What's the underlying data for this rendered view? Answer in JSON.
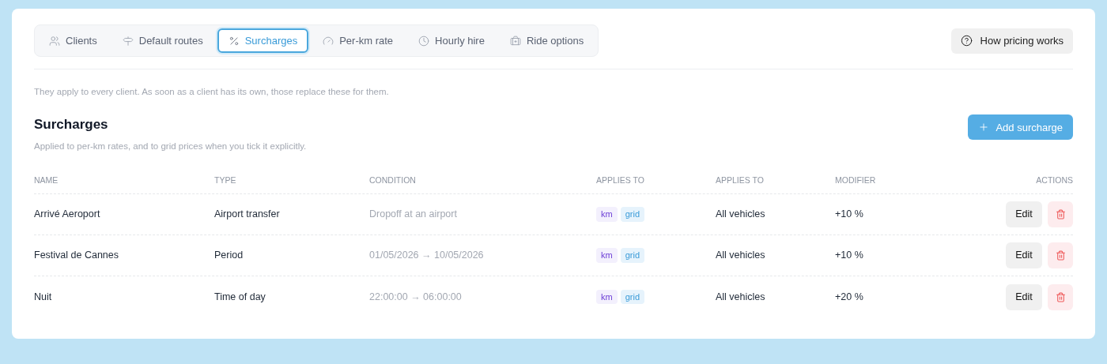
{
  "tabs": [
    {
      "label": "Clients",
      "selected": false
    },
    {
      "label": "Default routes",
      "selected": false
    },
    {
      "label": "Surcharges",
      "selected": true
    },
    {
      "label": "Per-km rate",
      "selected": false
    },
    {
      "label": "Hourly hire",
      "selected": false
    },
    {
      "label": "Ride options",
      "selected": false
    }
  ],
  "help_button": "How pricing works",
  "intro": "They apply to every client. As soon as a client has its own, those replace these for them.",
  "section": {
    "title": "Surcharges",
    "subtitle": "Applied to per-km rates, and to grid prices when you tick it explicitly.",
    "add_button": "Add surcharge"
  },
  "table": {
    "columns": [
      "NAME",
      "TYPE",
      "CONDITION",
      "APPLIES TO",
      "APPLIES TO",
      "MODIFIER",
      "ACTIONS"
    ],
    "rows": [
      {
        "name": "Arrivé Aeroport",
        "type": "Airport transfer",
        "condition": "Dropoff at an airport",
        "tags": [
          {
            "label": "km",
            "kind": "km"
          },
          {
            "label": "grid",
            "kind": "grid"
          }
        ],
        "vehicles": "All vehicles",
        "modifier": "+10 %",
        "edit": "Edit"
      },
      {
        "name": "Festival de Cannes",
        "type": "Period",
        "condition": "01/05/2026 → 10/05/2026",
        "tags": [
          {
            "label": "km",
            "kind": "km"
          },
          {
            "label": "grid",
            "kind": "grid"
          }
        ],
        "vehicles": "All vehicles",
        "modifier": "+10 %",
        "edit": "Edit"
      },
      {
        "name": "Nuit",
        "type": "Time of day",
        "condition": "22:00:00 → 06:00:00",
        "tags": [
          {
            "label": "km",
            "kind": "km"
          },
          {
            "label": "grid",
            "kind": "grid"
          }
        ],
        "vehicles": "All vehicles",
        "modifier": "+20 %",
        "edit": "Edit"
      }
    ]
  }
}
